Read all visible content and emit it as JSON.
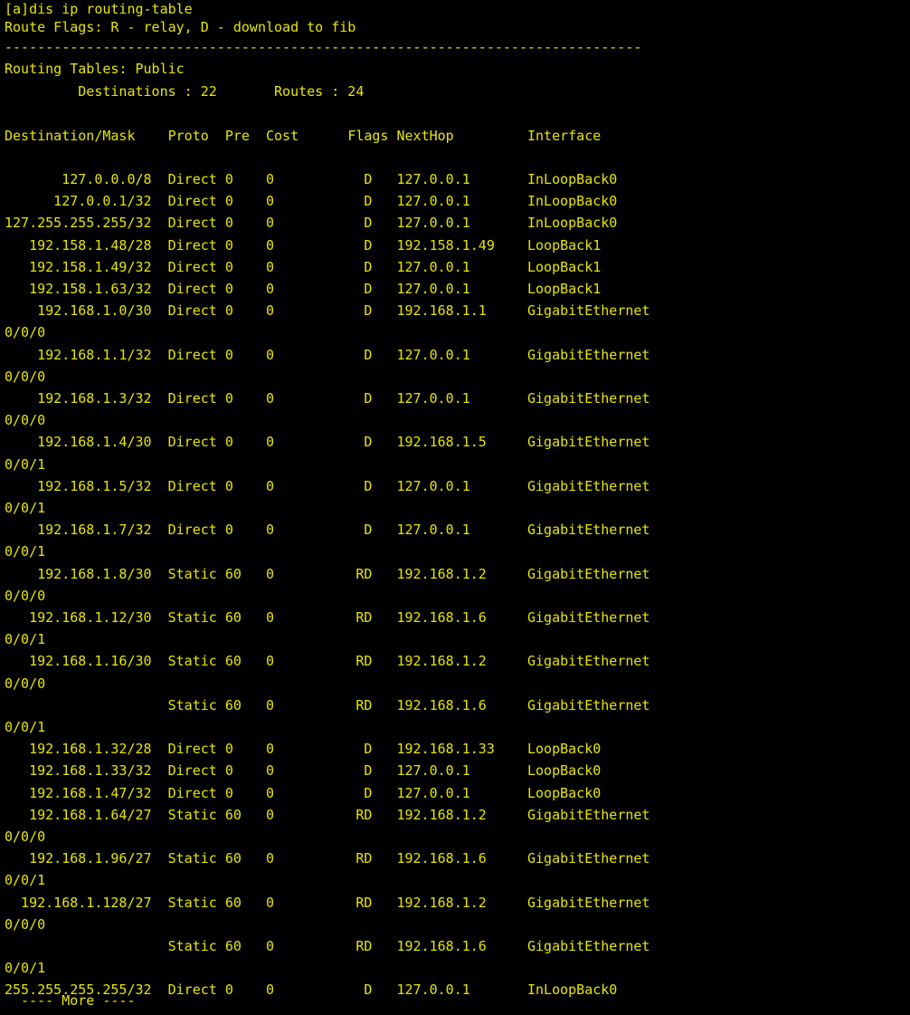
{
  "terminal": {
    "foreground": "#e6e600",
    "background": "#000000",
    "command_line": "[a]dis ip routing-table",
    "flags_legend": "Route Flags: R - relay, D - download to fib",
    "separator": "------------------------------------------------------------------------------",
    "table_name_line": "Routing Tables: Public",
    "summary_line": "         Destinations : 22       Routes : 24",
    "column_headers": {
      "destination_mask": "Destination/Mask",
      "proto": "Proto",
      "pre": "Pre",
      "cost": "Cost",
      "flags": "Flags",
      "nexthop": "NextHop",
      "interface": "Interface"
    },
    "routes": [
      {
        "destination": "127.0.0.0/8",
        "proto": "Direct",
        "pre": "0",
        "cost": "0",
        "flags": "D",
        "nexthop": "127.0.0.1",
        "interface": "InLoopBack0",
        "interface_cont": ""
      },
      {
        "destination": "127.0.0.1/32",
        "proto": "Direct",
        "pre": "0",
        "cost": "0",
        "flags": "D",
        "nexthop": "127.0.0.1",
        "interface": "InLoopBack0",
        "interface_cont": ""
      },
      {
        "destination": "127.255.255.255/32",
        "proto": "Direct",
        "pre": "0",
        "cost": "0",
        "flags": "D",
        "nexthop": "127.0.0.1",
        "interface": "InLoopBack0",
        "interface_cont": ""
      },
      {
        "destination": "192.158.1.48/28",
        "proto": "Direct",
        "pre": "0",
        "cost": "0",
        "flags": "D",
        "nexthop": "192.158.1.49",
        "interface": "LoopBack1",
        "interface_cont": ""
      },
      {
        "destination": "192.158.1.49/32",
        "proto": "Direct",
        "pre": "0",
        "cost": "0",
        "flags": "D",
        "nexthop": "127.0.0.1",
        "interface": "LoopBack1",
        "interface_cont": ""
      },
      {
        "destination": "192.158.1.63/32",
        "proto": "Direct",
        "pre": "0",
        "cost": "0",
        "flags": "D",
        "nexthop": "127.0.0.1",
        "interface": "LoopBack1",
        "interface_cont": ""
      },
      {
        "destination": "192.168.1.0/30",
        "proto": "Direct",
        "pre": "0",
        "cost": "0",
        "flags": "D",
        "nexthop": "192.168.1.1",
        "interface": "GigabitEthernet",
        "interface_cont": "0/0/0"
      },
      {
        "destination": "192.168.1.1/32",
        "proto": "Direct",
        "pre": "0",
        "cost": "0",
        "flags": "D",
        "nexthop": "127.0.0.1",
        "interface": "GigabitEthernet",
        "interface_cont": "0/0/0"
      },
      {
        "destination": "192.168.1.3/32",
        "proto": "Direct",
        "pre": "0",
        "cost": "0",
        "flags": "D",
        "nexthop": "127.0.0.1",
        "interface": "GigabitEthernet",
        "interface_cont": "0/0/0"
      },
      {
        "destination": "192.168.1.4/30",
        "proto": "Direct",
        "pre": "0",
        "cost": "0",
        "flags": "D",
        "nexthop": "192.168.1.5",
        "interface": "GigabitEthernet",
        "interface_cont": "0/0/1"
      },
      {
        "destination": "192.168.1.5/32",
        "proto": "Direct",
        "pre": "0",
        "cost": "0",
        "flags": "D",
        "nexthop": "127.0.0.1",
        "interface": "GigabitEthernet",
        "interface_cont": "0/0/1"
      },
      {
        "destination": "192.168.1.7/32",
        "proto": "Direct",
        "pre": "0",
        "cost": "0",
        "flags": "D",
        "nexthop": "127.0.0.1",
        "interface": "GigabitEthernet",
        "interface_cont": "0/0/1"
      },
      {
        "destination": "192.168.1.8/30",
        "proto": "Static",
        "pre": "60",
        "cost": "0",
        "flags": "RD",
        "nexthop": "192.168.1.2",
        "interface": "GigabitEthernet",
        "interface_cont": "0/0/0"
      },
      {
        "destination": "192.168.1.12/30",
        "proto": "Static",
        "pre": "60",
        "cost": "0",
        "flags": "RD",
        "nexthop": "192.168.1.6",
        "interface": "GigabitEthernet",
        "interface_cont": "0/0/1"
      },
      {
        "destination": "192.168.1.16/30",
        "proto": "Static",
        "pre": "60",
        "cost": "0",
        "flags": "RD",
        "nexthop": "192.168.1.2",
        "interface": "GigabitEthernet",
        "interface_cont": "0/0/0"
      },
      {
        "destination": "",
        "proto": "Static",
        "pre": "60",
        "cost": "0",
        "flags": "RD",
        "nexthop": "192.168.1.6",
        "interface": "GigabitEthernet",
        "interface_cont": "0/0/1"
      },
      {
        "destination": "192.168.1.32/28",
        "proto": "Direct",
        "pre": "0",
        "cost": "0",
        "flags": "D",
        "nexthop": "192.168.1.33",
        "interface": "LoopBack0",
        "interface_cont": ""
      },
      {
        "destination": "192.168.1.33/32",
        "proto": "Direct",
        "pre": "0",
        "cost": "0",
        "flags": "D",
        "nexthop": "127.0.0.1",
        "interface": "LoopBack0",
        "interface_cont": ""
      },
      {
        "destination": "192.168.1.47/32",
        "proto": "Direct",
        "pre": "0",
        "cost": "0",
        "flags": "D",
        "nexthop": "127.0.0.1",
        "interface": "LoopBack0",
        "interface_cont": ""
      },
      {
        "destination": "192.168.1.64/27",
        "proto": "Static",
        "pre": "60",
        "cost": "0",
        "flags": "RD",
        "nexthop": "192.168.1.2",
        "interface": "GigabitEthernet",
        "interface_cont": "0/0/0"
      },
      {
        "destination": "192.168.1.96/27",
        "proto": "Static",
        "pre": "60",
        "cost": "0",
        "flags": "RD",
        "nexthop": "192.168.1.6",
        "interface": "GigabitEthernet",
        "interface_cont": "0/0/1"
      },
      {
        "destination": "192.168.1.128/27",
        "proto": "Static",
        "pre": "60",
        "cost": "0",
        "flags": "RD",
        "nexthop": "192.168.1.2",
        "interface": "GigabitEthernet",
        "interface_cont": "0/0/0"
      },
      {
        "destination": "",
        "proto": "Static",
        "pre": "60",
        "cost": "0",
        "flags": "RD",
        "nexthop": "192.168.1.6",
        "interface": "GigabitEthernet",
        "interface_cont": "0/0/1"
      },
      {
        "destination": "255.255.255.255/32",
        "proto": "Direct",
        "pre": "0",
        "cost": "0",
        "flags": "D",
        "nexthop": "127.0.0.1",
        "interface": "InLoopBack0",
        "interface_cont": ""
      }
    ],
    "more_prompt": "  ---- More ----"
  }
}
